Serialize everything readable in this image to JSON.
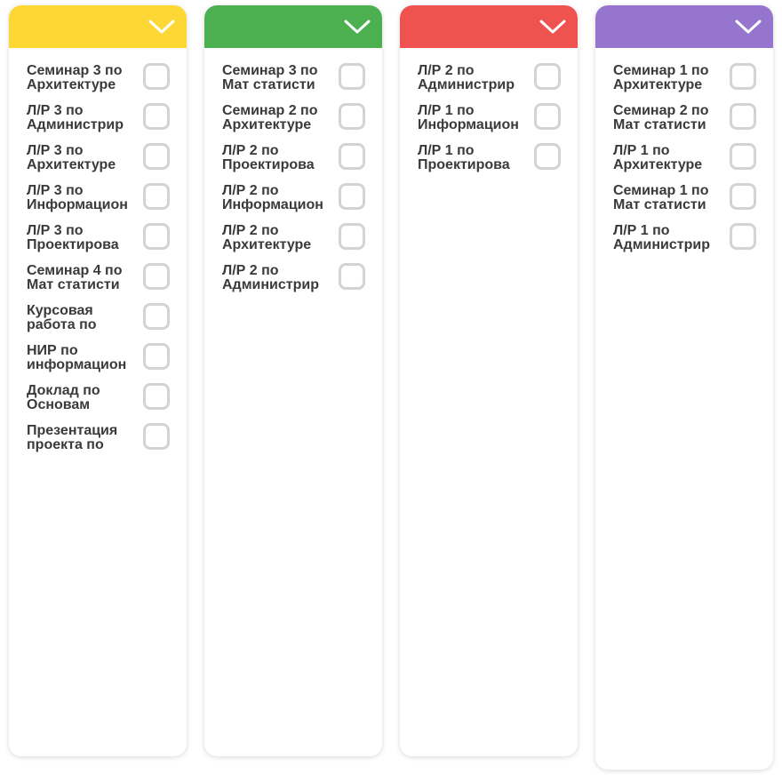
{
  "columns": [
    {
      "color": "#FDD835",
      "tasks": [
        "Семинар 3 по Архитектуре",
        "Л/Р 3 по Администрир",
        "Л/Р 3 по Архитектуре",
        "Л/Р 3 по Информацион",
        "Л/Р 3 по Проектирова",
        "Семинар 4 по Мат статисти",
        "Курсовая работа по",
        "НИР по информацион",
        "Доклад по Основам",
        "Презентация проекта по"
      ]
    },
    {
      "color": "#4CAF50",
      "tasks": [
        "Семинар 3 по Мат статисти",
        "Семинар 2 по Архитектуре",
        "Л/Р 2 по Проектирова",
        "Л/Р 2 по Информацион",
        "Л/Р 2 по Архитектуре",
        "Л/Р 2 по Администрир"
      ]
    },
    {
      "color": "#EF5350",
      "tasks": [
        "Л/Р 2 по Администрир",
        "Л/Р 1 по Информацион",
        "Л/Р 1 по Проектирова"
      ]
    },
    {
      "color": "#9575CD",
      "tasks": [
        "Семинар 1 по Архитектуре",
        "Семинар 2 по Мат статисти",
        "Л/Р 1 по Архитектуре",
        "Семинар 1 по Мат статисти",
        "Л/Р 1 по Администрир"
      ]
    }
  ]
}
